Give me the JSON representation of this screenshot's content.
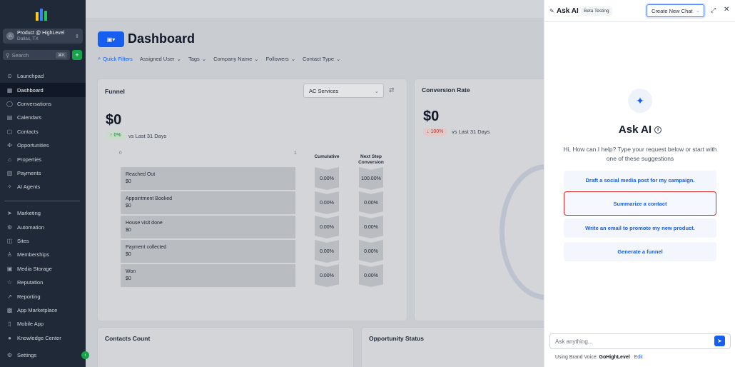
{
  "sidebar": {
    "account": {
      "name": "Product @ HighLevel",
      "location": "Dallas, TX"
    },
    "search": {
      "label": "Search",
      "shortcut": "⌘K"
    },
    "quick_add": "+",
    "nav_items": [
      {
        "label": "Launchpad",
        "icon": "⊙"
      },
      {
        "label": "Dashboard",
        "icon": "▦"
      },
      {
        "label": "Conversations",
        "icon": "◯"
      },
      {
        "label": "Calendars",
        "icon": "▤"
      },
      {
        "label": "Contacts",
        "icon": "▢"
      },
      {
        "label": "Opportunities",
        "icon": "✣"
      },
      {
        "label": "Properties",
        "icon": "⌂"
      },
      {
        "label": "Payments",
        "icon": "▥"
      },
      {
        "label": "AI Agents",
        "icon": "✧"
      }
    ],
    "nav_items_2": [
      {
        "label": "Marketing",
        "icon": "➤"
      },
      {
        "label": "Automation",
        "icon": "⚙"
      },
      {
        "label": "Sites",
        "icon": "◫"
      },
      {
        "label": "Memberships",
        "icon": "♙"
      },
      {
        "label": "Media Storage",
        "icon": "▣"
      },
      {
        "label": "Reputation",
        "icon": "☆"
      },
      {
        "label": "Reporting",
        "icon": "↗"
      },
      {
        "label": "App Marketplace",
        "icon": "▩"
      },
      {
        "label": "Mobile App",
        "icon": "▯"
      },
      {
        "label": "Knowledge Center",
        "icon": "●"
      }
    ],
    "settings": {
      "label": "Settings",
      "icon": "⚙"
    },
    "collapse": "‹"
  },
  "main": {
    "title": "Dashboard",
    "dashboard_button_icon": "▣▾",
    "filters": {
      "quick": "Quick Filters",
      "items": [
        "Assigned User",
        "Tags",
        "Company Name",
        "Followers",
        "Contact Type"
      ]
    },
    "funnel": {
      "title": "Funnel",
      "select_value": "AC Services",
      "value": "$0",
      "change": "↑ 0%",
      "vs": "vs Last 31 Days",
      "axis_min": "0",
      "axis_max": "1",
      "col_cumulative": "Cumulative",
      "col_next_step": "Next Step Conversion",
      "stages": [
        {
          "name": "Reached Out",
          "value": "$0",
          "cumulative": "0.00%",
          "next": "100.00%"
        },
        {
          "name": "Appointment Booked",
          "value": "$0",
          "cumulative": "0.00%",
          "next": "0.00%"
        },
        {
          "name": "House visit done",
          "value": "$0",
          "cumulative": "0.00%",
          "next": "0.00%"
        },
        {
          "name": "Payment collected",
          "value": "$0",
          "cumulative": "0.00%",
          "next": "0.00%"
        },
        {
          "name": "Won",
          "value": "$0",
          "cumulative": "0.00%",
          "next": "0.00%"
        }
      ]
    },
    "conversion": {
      "title": "Conversion Rate",
      "value": "$0",
      "change": "↓ 100%",
      "vs": "vs Last 31 Days"
    },
    "contacts_count": {
      "title": "Contacts Count"
    },
    "opportunity_status": {
      "title": "Opportunity Status"
    }
  },
  "ai": {
    "title": "Ask AI",
    "badge": "Beta Testing",
    "new_chat": "Create New Chat",
    "heading": "Ask AI",
    "description": "Hi, How can I help? Type your request below or start with one of these suggestions",
    "suggestions": [
      "Draft a social media post for my campaign.",
      "Summarize a contact",
      "Write an email to promote my new product.",
      "Generate a funnel"
    ],
    "input_placeholder": "Ask anything...",
    "brand_voice_label": "Using Brand Voice:",
    "brand_voice_value": "GoHighLevel",
    "edit": "Edit"
  }
}
